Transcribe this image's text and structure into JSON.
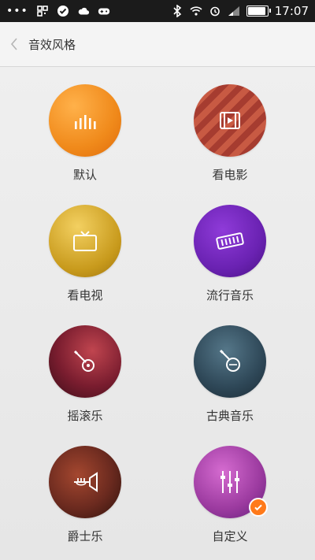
{
  "status_bar": {
    "time": "17:07",
    "dots": "•••",
    "icons": [
      "qr-icon",
      "check-circle-icon",
      "cloud-icon",
      "game-icon",
      "bluetooth-icon",
      "wifi-icon",
      "alarm-icon",
      "signal-icon",
      "battery-icon"
    ],
    "battery_level": 0.9
  },
  "header": {
    "back_icon": "chevron-left-icon",
    "title": "音效风格"
  },
  "styles": [
    {
      "label": "默认",
      "icon": "equalizer-bars-icon",
      "color": "#f08a1b"
    },
    {
      "label": "看电影",
      "icon": "movie-play-icon",
      "color": "#b54a38"
    },
    {
      "label": "看电视",
      "icon": "tv-icon",
      "color": "#c89a1c"
    },
    {
      "label": "流行音乐",
      "icon": "keyboard-icon",
      "color": "#6a22b2"
    },
    {
      "label": "摇滚乐",
      "icon": "electric-guitar-icon",
      "color": "#7a1d2f"
    },
    {
      "label": "古典音乐",
      "icon": "banjo-icon",
      "color": "#2e4757"
    },
    {
      "label": "爵士乐",
      "icon": "trumpet-icon",
      "color": "#6b2a1f"
    },
    {
      "label": "自定义",
      "icon": "sliders-icon",
      "color": "#9b3a9f",
      "selected": true
    }
  ],
  "accent_color": "#ff7a1a"
}
